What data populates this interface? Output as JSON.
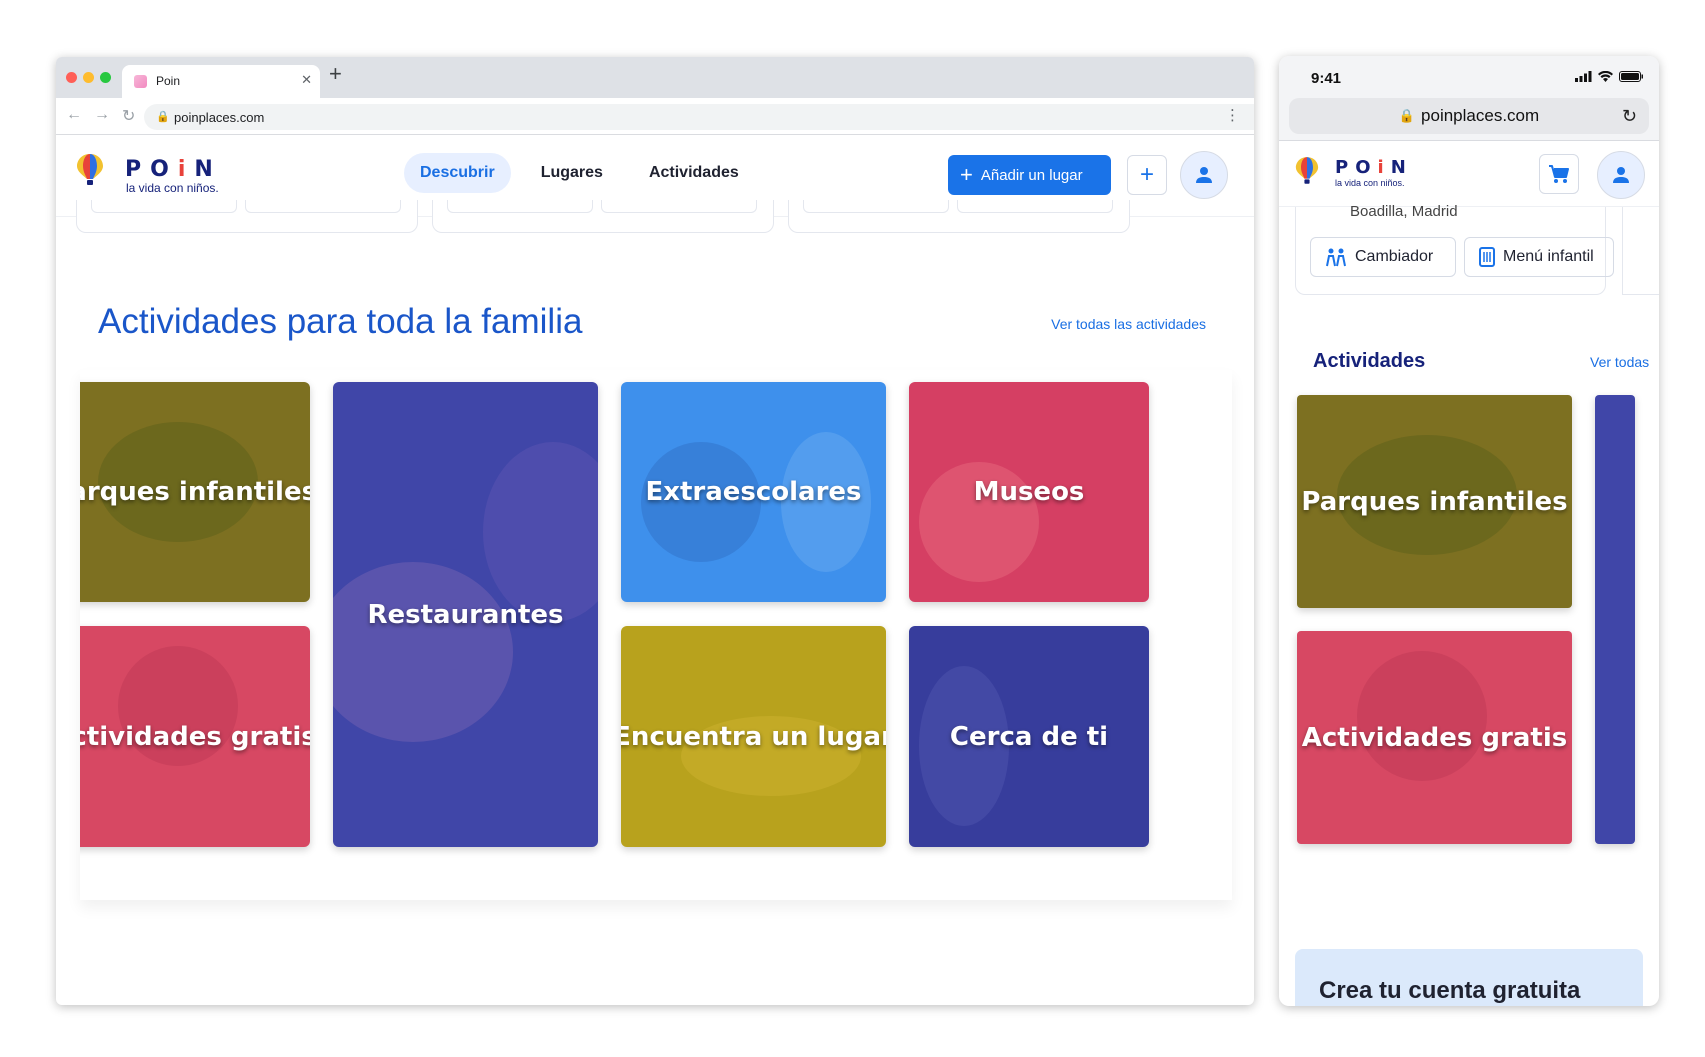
{
  "browser": {
    "tab_title": "Poin",
    "url": "poinplaces.com"
  },
  "site": {
    "brand": "POiN",
    "brand_letters": [
      "P",
      "O",
      "i",
      "N"
    ],
    "tagline": "la vida con niños.",
    "nav": [
      {
        "label": "Descubrir",
        "active": true
      },
      {
        "label": "Lugares",
        "active": false
      },
      {
        "label": "Actividades",
        "active": false
      }
    ],
    "cta_label": "Añadir un lugar"
  },
  "section": {
    "title": "Actividades para toda la familia",
    "see_all": "Ver todas las actividades"
  },
  "tiles": [
    {
      "label": "Parques infantiles",
      "color": "#7d7021"
    },
    {
      "label": "Restaurantes",
      "color": "#4046a8"
    },
    {
      "label": "Extraescolares",
      "color": "#3e90ec"
    },
    {
      "label": "Museos",
      "color": "#d53f63"
    },
    {
      "label": "Actividades gratis",
      "color": "#d74863"
    },
    {
      "label": "Encuentra un lugar",
      "color": "#b8a21d"
    },
    {
      "label": "Cerca de ti",
      "color": "#373d9c"
    }
  ],
  "mobile": {
    "time": "9:41",
    "url": "poinplaces.com",
    "location": "Boadilla, Madrid",
    "chips": [
      "Cambiador",
      "Menú infantil"
    ],
    "section_title": "Actividades",
    "see_all": "Ver todas",
    "tiles": [
      "Parques infantiles",
      "Actividades gratis"
    ],
    "promo_title": "Crea tu cuenta gratuita"
  },
  "colors": {
    "brand_navy": "#16227a",
    "brand_red": "#e8423a",
    "primary": "#1a73e8",
    "title_blue": "#1a56c9"
  }
}
